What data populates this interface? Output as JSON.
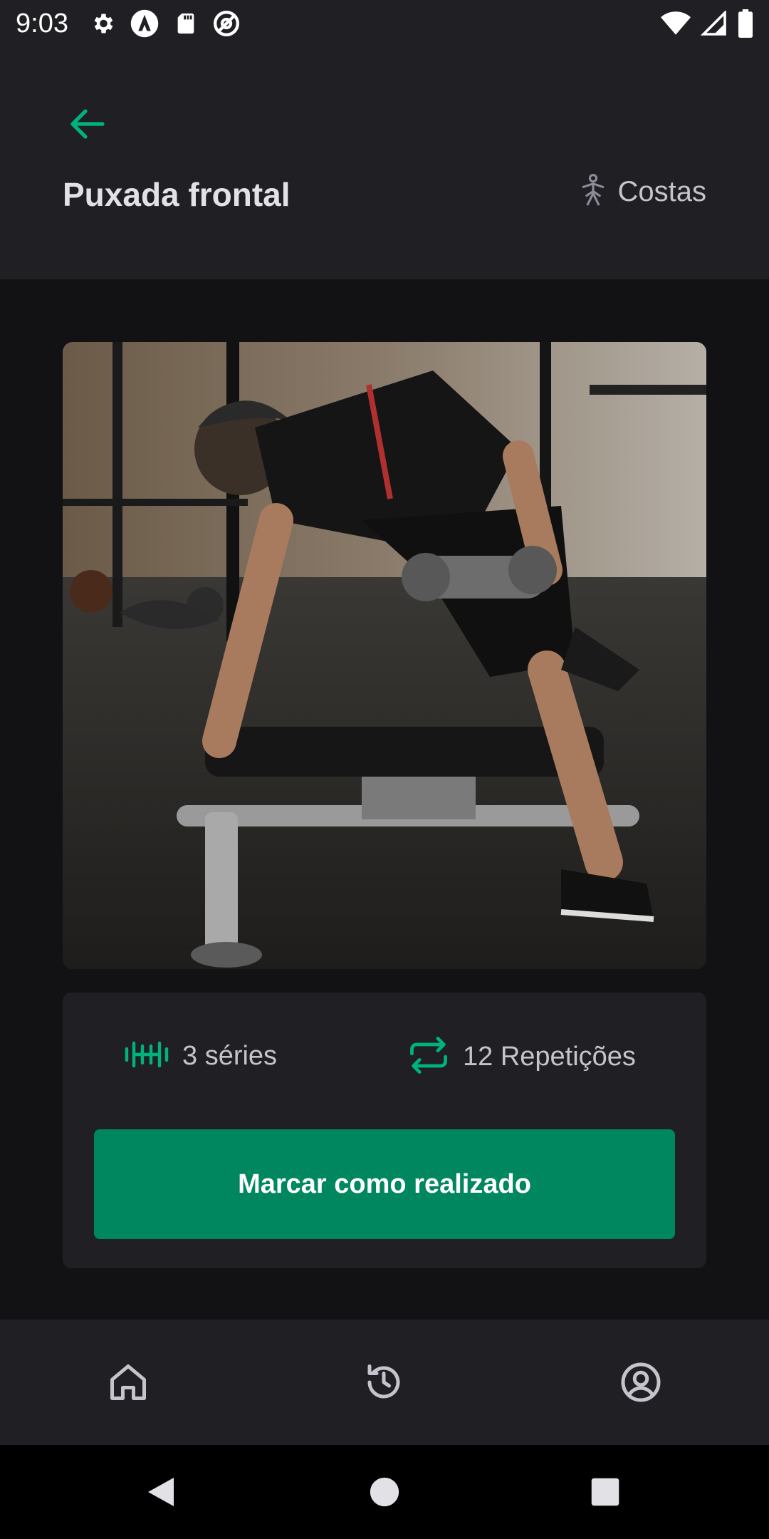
{
  "status_bar": {
    "time": "9:03",
    "left_icons": [
      "gear-icon",
      "app-a-icon",
      "sd-card-icon",
      "at-sign-icon"
    ],
    "right_icons": [
      "wifi-icon",
      "signal-icon",
      "battery-icon"
    ]
  },
  "header": {
    "title": "Puxada frontal",
    "group": "Costas",
    "back_icon": "arrow-left-icon",
    "group_icon": "body-icon"
  },
  "exercise": {
    "image_icon": "photo"
  },
  "info": {
    "series_label": "3 séries",
    "reps_label": "12 Repetições",
    "series_icon": "dumbbell-icon",
    "reps_icon": "repeat-icon",
    "button_label": "Marcar como realizado"
  },
  "bottom_nav": {
    "items": [
      {
        "icon": "home-icon"
      },
      {
        "icon": "history-icon"
      },
      {
        "icon": "profile-icon"
      }
    ]
  },
  "system_nav": {
    "items": [
      "back-triangle-icon",
      "home-circle-icon",
      "recents-square-icon"
    ]
  },
  "colors": {
    "accent": "#00875F",
    "accent_light": "#00B37E",
    "header_bg": "#202024",
    "body_bg": "#121214",
    "text_primary": "#E1E1E6",
    "text_secondary": "#C4C4CC"
  }
}
